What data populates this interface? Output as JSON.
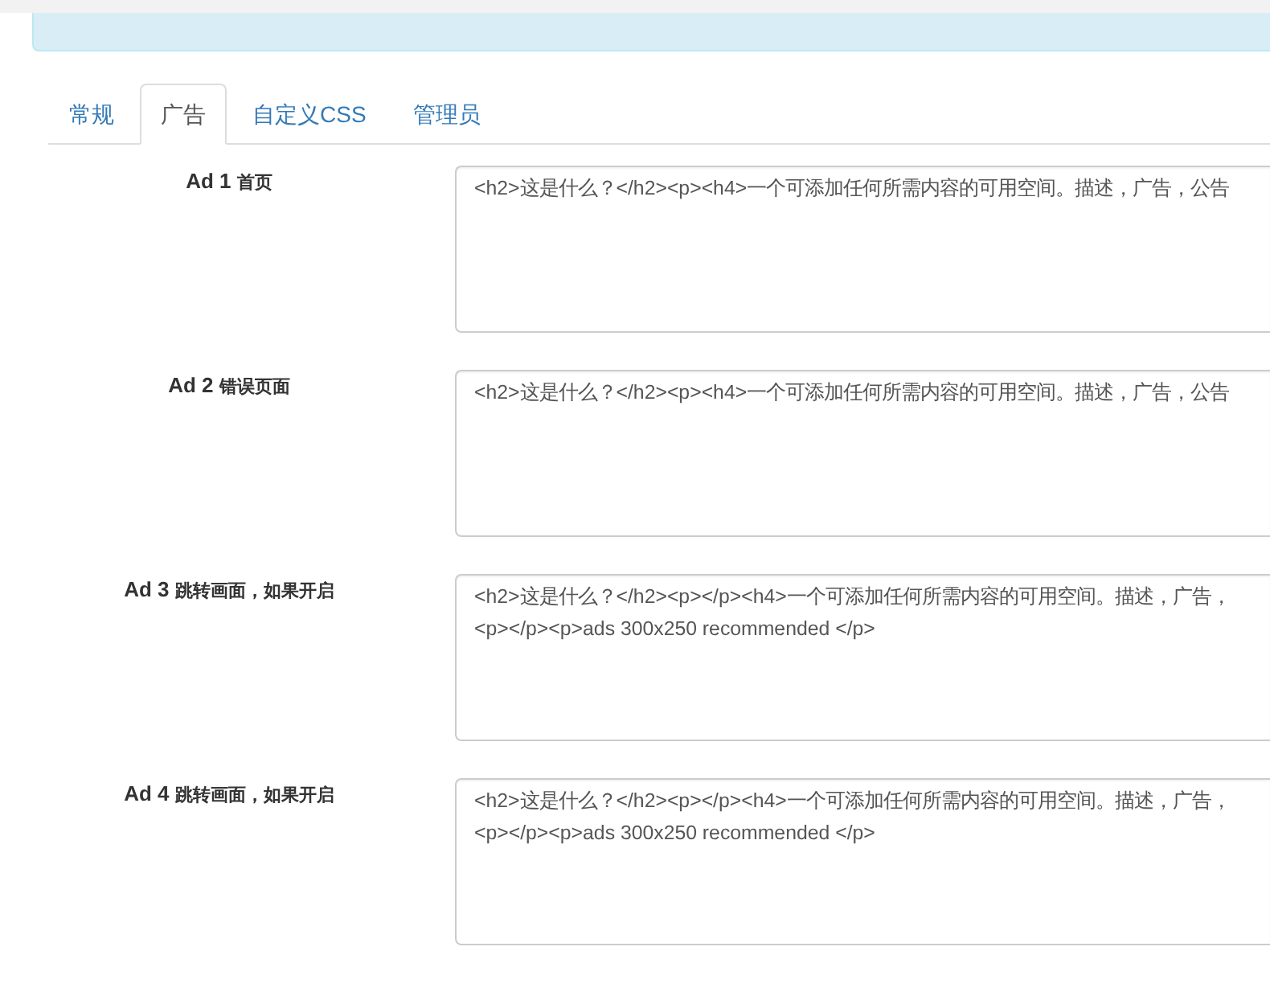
{
  "tabs": [
    {
      "label": "常规",
      "selected": false
    },
    {
      "label": "广告",
      "selected": true
    },
    {
      "label": "自定义CSS",
      "selected": false
    },
    {
      "label": "管理员",
      "selected": false
    }
  ],
  "ad_slots": [
    {
      "label": "Ad 1",
      "note": "首页",
      "code_lines": [
        "<h2>这是什么？</h2><p><h4>一个可添加任何所需内容的可用空间。描述，广告，公告"
      ]
    },
    {
      "label": "Ad 2",
      "note": "错误页面",
      "code_lines": [
        "<h2>这是什么？</h2><p><h4>一个可添加任何所需内容的可用空间。描述，广告，公告"
      ]
    },
    {
      "label": "Ad 3",
      "note": "跳转画面，如果开启",
      "code_lines": [
        "<h2>这是什么？</h2><p></p><h4>一个可添加任何所需内容的可用空间。描述，广告，",
        "<p></p><p>ads 300x250 recommended </p>"
      ]
    },
    {
      "label": "Ad 4",
      "note": "跳转画面，如果开启",
      "code_lines": [
        "<h2>这是什么？</h2><p></p><h4>一个可添加任何所需内容的可用空间。描述，广告，",
        "<p></p><p>ads 300x250 recommended </p>"
      ]
    }
  ]
}
